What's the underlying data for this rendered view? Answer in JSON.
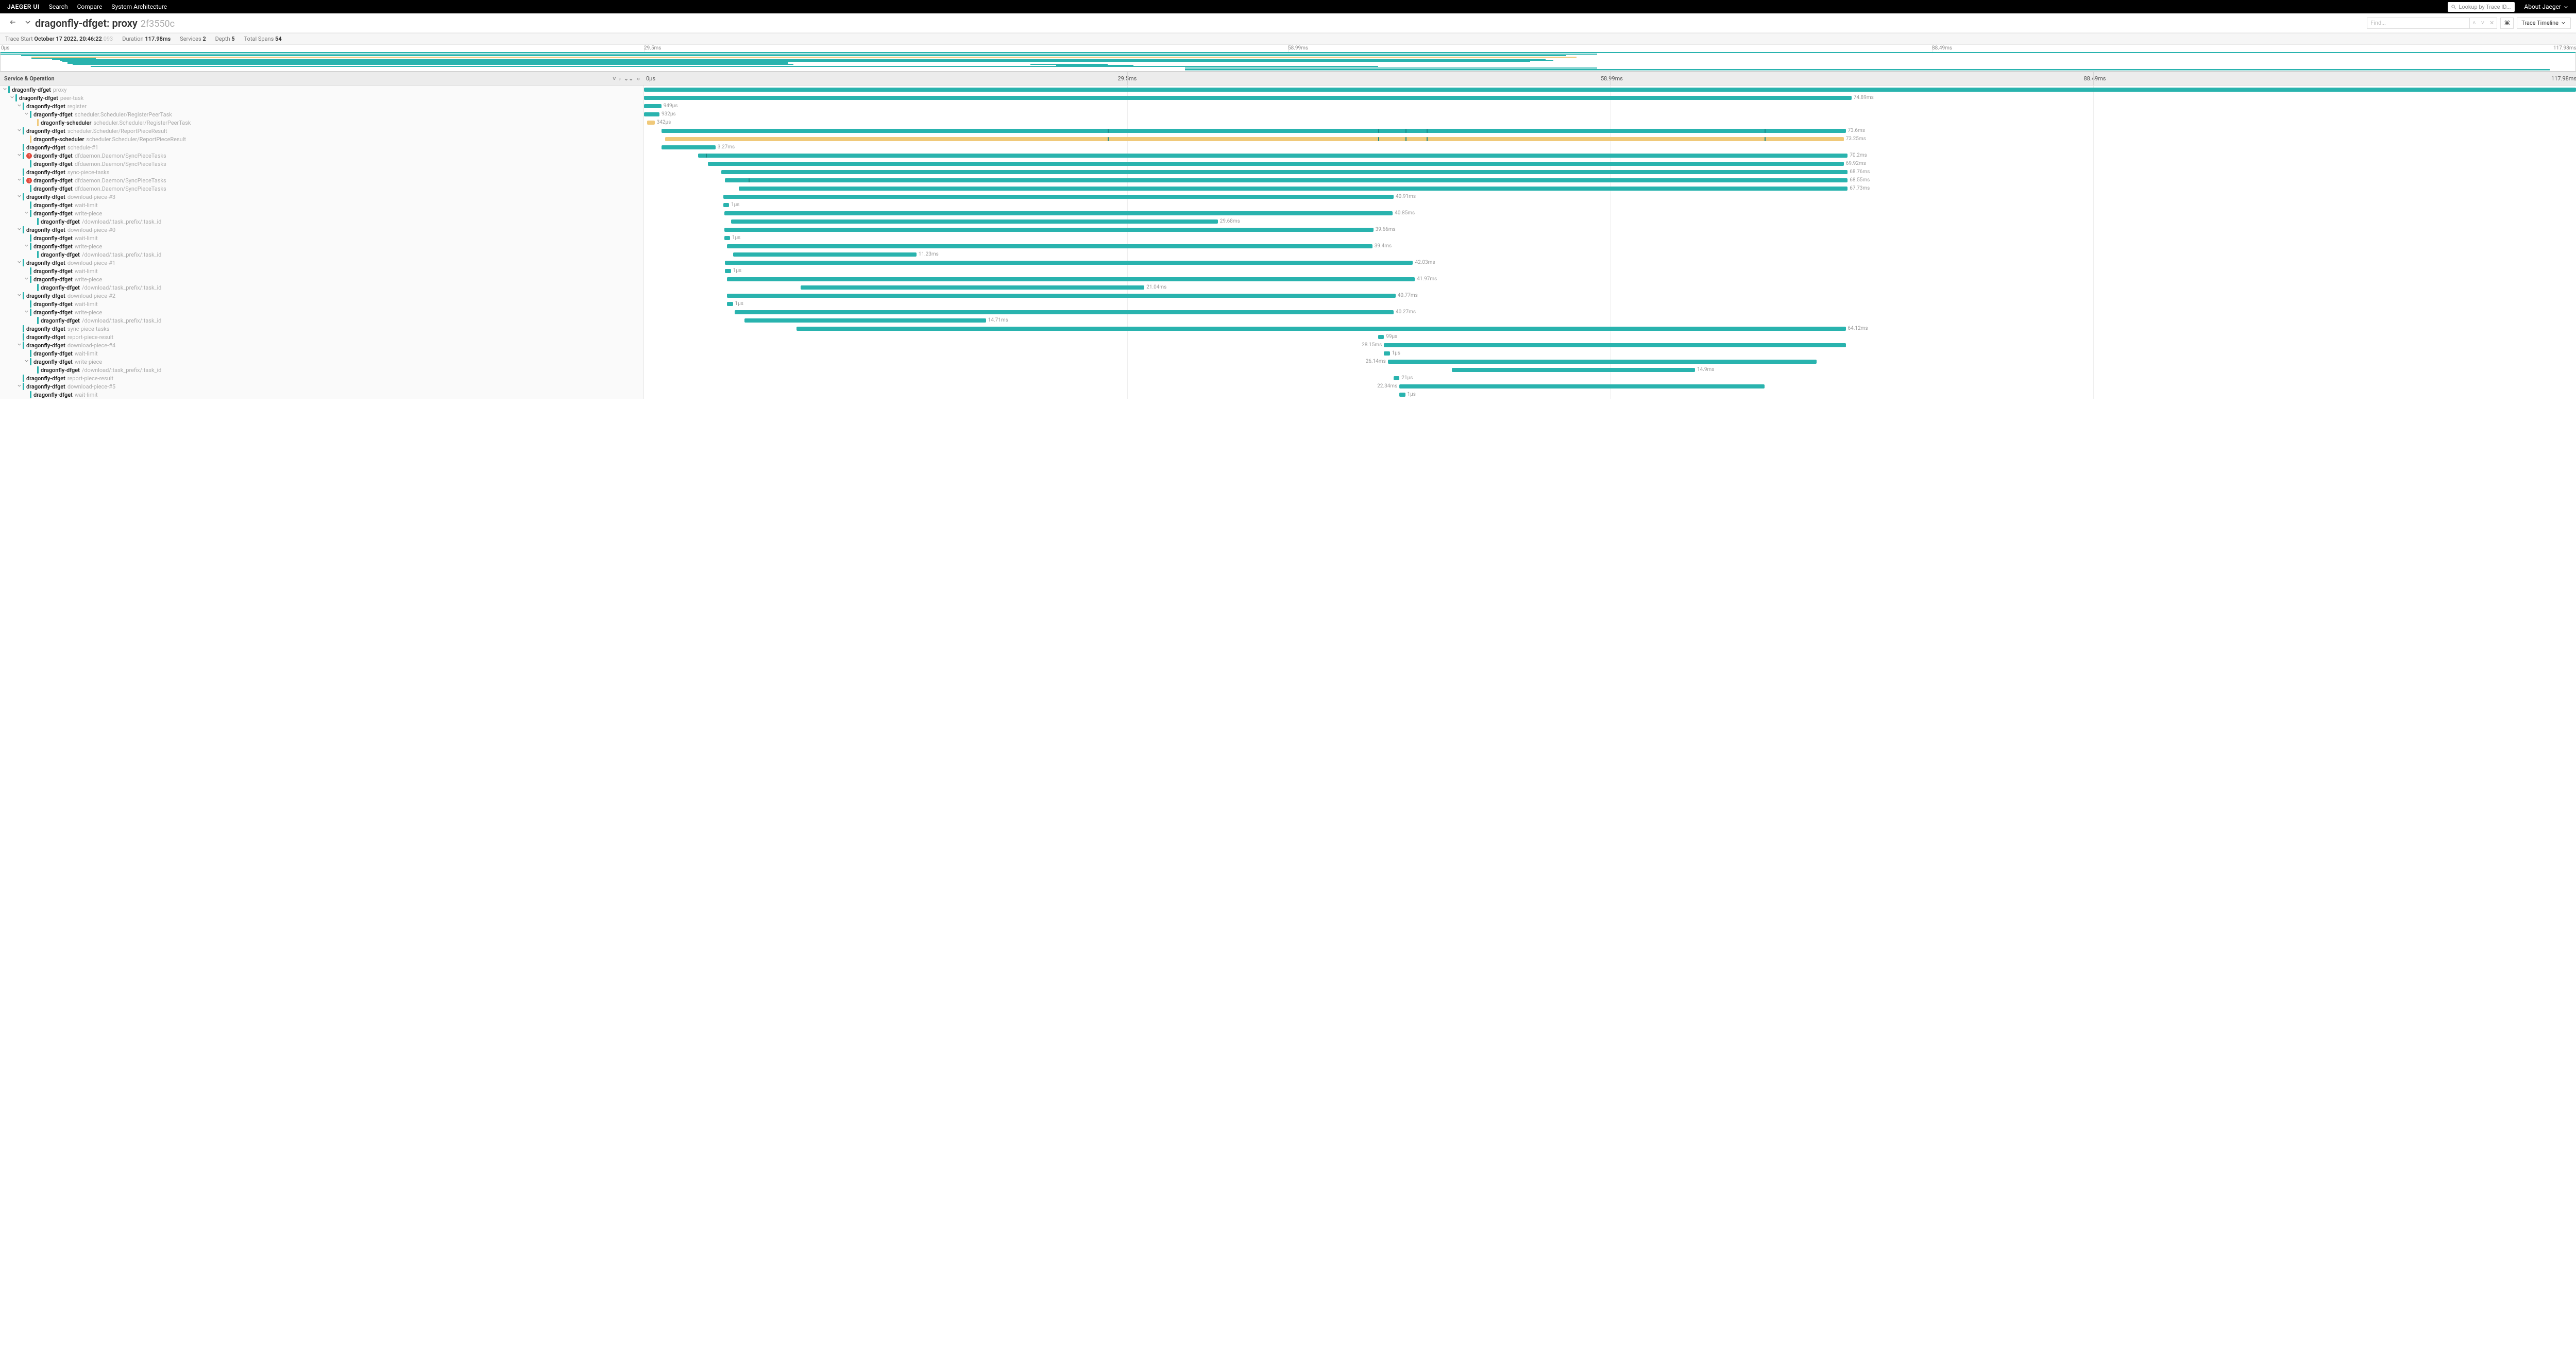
{
  "colors": {
    "teal": "#29b3ae",
    "tealDark": "#1b8a86",
    "amber": "#f0c97a",
    "grey": "#888"
  },
  "nav": {
    "brand": "JAEGER UI",
    "items": [
      "Search",
      "Compare",
      "System Architecture"
    ],
    "search_placeholder": "Lookup by Trace ID...",
    "about": "About Jaeger"
  },
  "header": {
    "title_service": "dragonfly-dfget: proxy",
    "trace_id": "2f3550c",
    "find_placeholder": "Find...",
    "kbd_glyph": "⌘",
    "view_label": "Trace Timeline"
  },
  "meta": {
    "start_label": "Trace Start",
    "start_value": "October 17 2022, 20:46:22",
    "start_frac": ".093",
    "duration_label": "Duration",
    "duration_value": "117.98ms",
    "services_label": "Services",
    "services_value": "2",
    "depth_label": "Depth",
    "depth_value": "5",
    "spans_label": "Total Spans",
    "spans_value": "54"
  },
  "ticks": [
    "0µs",
    "29.5ms",
    "58.99ms",
    "88.49ms",
    "117.98ms"
  ],
  "columns": {
    "left_label": "Service & Operation"
  },
  "minimap": {
    "bars": [
      {
        "t": 0,
        "l": 0,
        "w": 100,
        "c": "t"
      },
      {
        "t": 3,
        "l": 0,
        "w": 62,
        "c": "t"
      },
      {
        "t": 6,
        "l": 0.8,
        "w": 60,
        "c": "t"
      },
      {
        "t": 9,
        "l": 1.2,
        "w": 60,
        "c": "y"
      },
      {
        "t": 11,
        "l": 1.2,
        "w": 2.5,
        "c": "t"
      },
      {
        "t": 13,
        "l": 2,
        "w": 58,
        "c": "t"
      },
      {
        "t": 15,
        "l": 2.3,
        "w": 58,
        "c": "t"
      },
      {
        "t": 17,
        "l": 2.4,
        "w": 57,
        "c": "t"
      },
      {
        "t": 19,
        "l": 2.6,
        "w": 28,
        "c": "t"
      },
      {
        "t": 21,
        "l": 2.6,
        "w": 28,
        "c": "t"
      },
      {
        "t": 23,
        "l": 2.8,
        "w": 28,
        "c": "t"
      },
      {
        "t": 23,
        "l": 40,
        "w": 3,
        "c": "t"
      },
      {
        "t": 25,
        "l": 41,
        "w": 3,
        "c": "t"
      },
      {
        "t": 27,
        "l": 3.5,
        "w": 50,
        "c": "t"
      },
      {
        "t": 30,
        "l": 46,
        "w": 16,
        "c": "t"
      },
      {
        "t": 33,
        "l": 46,
        "w": 53,
        "c": "t"
      },
      {
        "t": 36,
        "l": 46,
        "w": 53,
        "c": "t"
      }
    ]
  },
  "spans": [
    {
      "d": 0,
      "svc": "dragonfly-dfget",
      "op": "proxy",
      "col": "t",
      "caret": true,
      "err": false,
      "start": 0,
      "width": 100,
      "dur": ""
    },
    {
      "d": 1,
      "svc": "dragonfly-dfget",
      "op": "peer-task",
      "col": "t",
      "caret": true,
      "err": false,
      "start": 0,
      "width": 62.5,
      "dur": "74.89ms"
    },
    {
      "d": 2,
      "svc": "dragonfly-dfget",
      "op": "register",
      "col": "t",
      "caret": true,
      "err": false,
      "start": 0,
      "width": 0.9,
      "dur": "949µs"
    },
    {
      "d": 3,
      "svc": "dragonfly-dfget",
      "op": "scheduler.Scheduler/RegisterPeerTask",
      "col": "t",
      "caret": true,
      "err": false,
      "start": 0,
      "width": 0.8,
      "dur": "932µs"
    },
    {
      "d": 4,
      "svc": "dragonfly-scheduler",
      "op": "scheduler.Scheduler/RegisterPeerTask",
      "col": "y",
      "caret": false,
      "err": false,
      "start": 0.15,
      "width": 0.4,
      "dur": "342µs"
    },
    {
      "d": 2,
      "svc": "dragonfly-dfget",
      "op": "scheduler.Scheduler/ReportPieceResult",
      "col": "t",
      "caret": true,
      "err": false,
      "start": 0.9,
      "width": 61.3,
      "dur": "73.6ms",
      "ticks": [
        24,
        38,
        39.4,
        40.5,
        58
      ]
    },
    {
      "d": 3,
      "svc": "dragonfly-scheduler",
      "op": "scheduler.Scheduler/ReportPieceResult",
      "col": "y",
      "caret": false,
      "err": false,
      "start": 1.1,
      "width": 61.0,
      "dur": "73.25ms",
      "ticks": [
        24,
        38,
        39.4,
        40.5,
        58
      ]
    },
    {
      "d": 2,
      "svc": "dragonfly-dfget",
      "op": "schedule-#1",
      "col": "t",
      "caret": false,
      "err": false,
      "start": 0.9,
      "width": 2.8,
      "dur": "3.27ms"
    },
    {
      "d": 2,
      "svc": "dragonfly-dfget",
      "op": "dfdaemon.Daemon/SyncPieceTasks",
      "col": "t",
      "caret": true,
      "err": true,
      "start": 2.8,
      "width": 59.5,
      "dur": "70.2ms",
      "ticks": [
        3.2
      ]
    },
    {
      "d": 3,
      "svc": "dragonfly-dfget",
      "op": "dfdaemon.Daemon/SyncPieceTasks",
      "col": "t",
      "caret": false,
      "err": false,
      "start": 3.3,
      "width": 58.8,
      "dur": "69.92ms"
    },
    {
      "d": 2,
      "svc": "dragonfly-dfget",
      "op": "sync-piece-tasks",
      "col": "t",
      "caret": false,
      "err": false,
      "start": 4.0,
      "width": 58.3,
      "dur": "68.76ms"
    },
    {
      "d": 2,
      "svc": "dragonfly-dfget",
      "op": "dfdaemon.Daemon/SyncPieceTasks",
      "col": "t",
      "caret": true,
      "err": true,
      "start": 4.2,
      "width": 58.1,
      "dur": "68.55ms",
      "ticks": [
        5.4
      ]
    },
    {
      "d": 3,
      "svc": "dragonfly-dfget",
      "op": "dfdaemon.Daemon/SyncPieceTasks",
      "col": "t",
      "caret": false,
      "err": false,
      "start": 4.9,
      "width": 57.4,
      "dur": "67.73ms"
    },
    {
      "d": 2,
      "svc": "dragonfly-dfget",
      "op": "download-piece-#3",
      "col": "t",
      "caret": true,
      "err": false,
      "start": 4.1,
      "width": 34.7,
      "dur": "40.91ms"
    },
    {
      "d": 3,
      "svc": "dragonfly-dfget",
      "op": "wait-limit",
      "col": "t",
      "caret": false,
      "err": false,
      "start": 4.1,
      "width": 0.3,
      "dur": "1µs"
    },
    {
      "d": 3,
      "svc": "dragonfly-dfget",
      "op": "write-piece",
      "col": "t",
      "caret": true,
      "err": false,
      "start": 4.15,
      "width": 34.6,
      "dur": "40.85ms"
    },
    {
      "d": 4,
      "svc": "dragonfly-dfget",
      "op": "/download/:task_prefix/:task_id",
      "col": "t",
      "caret": false,
      "err": false,
      "start": 4.5,
      "width": 25.2,
      "dur": "29.68ms"
    },
    {
      "d": 2,
      "svc": "dragonfly-dfget",
      "op": "download-piece-#0",
      "col": "t",
      "caret": true,
      "err": false,
      "start": 4.15,
      "width": 33.6,
      "dur": "39.66ms"
    },
    {
      "d": 3,
      "svc": "dragonfly-dfget",
      "op": "wait-limit",
      "col": "t",
      "caret": false,
      "err": false,
      "start": 4.15,
      "width": 0.3,
      "dur": "1µs"
    },
    {
      "d": 3,
      "svc": "dragonfly-dfget",
      "op": "write-piece",
      "col": "t",
      "caret": true,
      "err": false,
      "start": 4.3,
      "width": 33.4,
      "dur": "39.4ms"
    },
    {
      "d": 4,
      "svc": "dragonfly-dfget",
      "op": "/download/:task_prefix/:task_id",
      "col": "t",
      "caret": false,
      "err": false,
      "start": 4.6,
      "width": 9.5,
      "dur": "11.23ms"
    },
    {
      "d": 2,
      "svc": "dragonfly-dfget",
      "op": "download-piece-#1",
      "col": "t",
      "caret": true,
      "err": false,
      "start": 4.2,
      "width": 35.6,
      "dur": "42.03ms"
    },
    {
      "d": 3,
      "svc": "dragonfly-dfget",
      "op": "wait-limit",
      "col": "t",
      "caret": false,
      "err": false,
      "start": 4.2,
      "width": 0.3,
      "dur": "1µs"
    },
    {
      "d": 3,
      "svc": "dragonfly-dfget",
      "op": "write-piece",
      "col": "t",
      "caret": true,
      "err": false,
      "start": 4.3,
      "width": 35.6,
      "dur": "41.97ms"
    },
    {
      "d": 4,
      "svc": "dragonfly-dfget",
      "op": "/download/:task_prefix/:task_id",
      "col": "t",
      "caret": false,
      "err": false,
      "start": 8.1,
      "width": 17.8,
      "dur": "21.04ms"
    },
    {
      "d": 2,
      "svc": "dragonfly-dfget",
      "op": "download-piece-#2",
      "col": "t",
      "caret": true,
      "err": false,
      "start": 4.3,
      "width": 34.6,
      "dur": "40.77ms"
    },
    {
      "d": 3,
      "svc": "dragonfly-dfget",
      "op": "wait-limit",
      "col": "t",
      "caret": false,
      "err": false,
      "start": 4.3,
      "width": 0.3,
      "dur": "1µs"
    },
    {
      "d": 3,
      "svc": "dragonfly-dfget",
      "op": "write-piece",
      "col": "t",
      "caret": true,
      "err": false,
      "start": 4.7,
      "width": 34.1,
      "dur": "40.27ms"
    },
    {
      "d": 4,
      "svc": "dragonfly-dfget",
      "op": "/download/:task_prefix/:task_id",
      "col": "t",
      "caret": false,
      "err": false,
      "start": 5.2,
      "width": 12.5,
      "dur": "14.71ms"
    },
    {
      "d": 2,
      "svc": "dragonfly-dfget",
      "op": "sync-piece-tasks",
      "col": "t",
      "caret": false,
      "err": false,
      "start": 7.9,
      "width": 54.3,
      "dur": "64.12ms"
    },
    {
      "d": 2,
      "svc": "dragonfly-dfget",
      "op": "report-piece-result",
      "col": "t",
      "caret": false,
      "err": false,
      "start": 38.0,
      "width": 0.3,
      "dur": "99µs"
    },
    {
      "d": 2,
      "svc": "dragonfly-dfget",
      "op": "download-piece-#4",
      "col": "t",
      "caret": true,
      "err": false,
      "start": 38.3,
      "width": 23.9,
      "dur": "28.15ms",
      "durside": "left"
    },
    {
      "d": 3,
      "svc": "dragonfly-dfget",
      "op": "wait-limit",
      "col": "t",
      "caret": false,
      "err": false,
      "start": 38.3,
      "width": 0.3,
      "dur": "1µs"
    },
    {
      "d": 3,
      "svc": "dragonfly-dfget",
      "op": "write-piece",
      "col": "t",
      "caret": true,
      "err": false,
      "start": 38.5,
      "width": 22.2,
      "dur": "26.14ms",
      "durside": "left"
    },
    {
      "d": 4,
      "svc": "dragonfly-dfget",
      "op": "/download/:task_prefix/:task_id",
      "col": "t",
      "caret": false,
      "err": false,
      "start": 41.8,
      "width": 12.6,
      "dur": "14.9ms"
    },
    {
      "d": 2,
      "svc": "dragonfly-dfget",
      "op": "report-piece-result",
      "col": "t",
      "caret": false,
      "err": false,
      "start": 38.8,
      "width": 0.3,
      "dur": "21µs"
    },
    {
      "d": 2,
      "svc": "dragonfly-dfget",
      "op": "download-piece-#5",
      "col": "t",
      "caret": true,
      "err": false,
      "start": 39.1,
      "width": 18.9,
      "dur": "22.34ms",
      "durside": "left"
    },
    {
      "d": 3,
      "svc": "dragonfly-dfget",
      "op": "wait-limit",
      "col": "t",
      "caret": false,
      "err": false,
      "start": 39.1,
      "width": 0.3,
      "dur": "1µs"
    }
  ]
}
